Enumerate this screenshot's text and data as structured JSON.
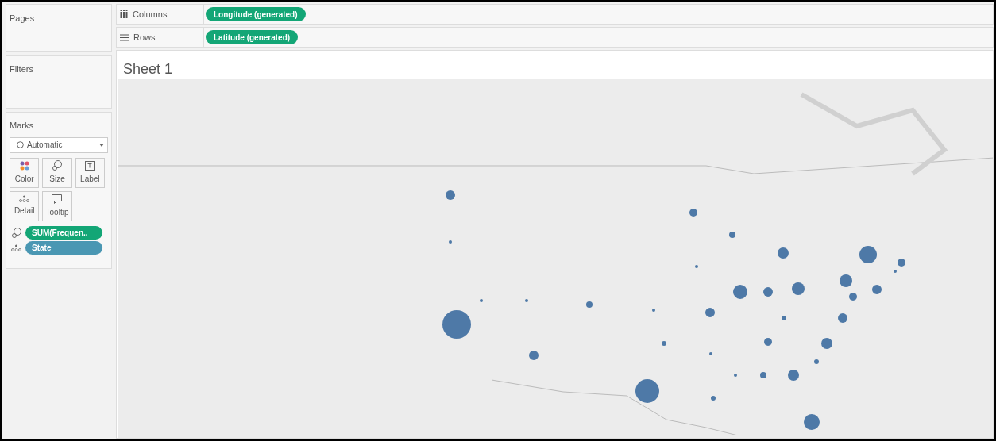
{
  "pages": {
    "title": "Pages"
  },
  "filters": {
    "title": "Filters"
  },
  "marks": {
    "title": "Marks",
    "mark_type": "Automatic",
    "cards": [
      {
        "kind": "color",
        "label": "Color"
      },
      {
        "kind": "size",
        "label": "Size"
      },
      {
        "kind": "label",
        "label": "Label"
      },
      {
        "kind": "detail",
        "label": "Detail"
      },
      {
        "kind": "tooltip",
        "label": "Tooltip"
      }
    ],
    "fields": [
      {
        "kind": "size",
        "label": "SUM(Frequen..",
        "color": "#13a676"
      },
      {
        "kind": "detail",
        "label": "State",
        "color": "#4a97b3"
      }
    ]
  },
  "shelves": [
    {
      "kind": "columns",
      "label": "Columns",
      "pills": [
        {
          "label": "Longitude (generated)",
          "color": "#13a676"
        }
      ]
    },
    {
      "kind": "rows",
      "label": "Rows",
      "pills": [
        {
          "label": "Latitude (generated)",
          "color": "#13a676"
        }
      ]
    }
  ],
  "sheet": {
    "title": "Sheet 1"
  }
}
